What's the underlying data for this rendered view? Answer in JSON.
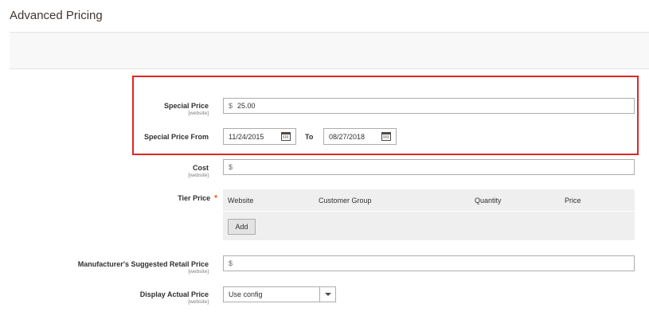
{
  "page": {
    "title": "Advanced Pricing"
  },
  "fields": {
    "special_price": {
      "label": "Special Price",
      "scope": "[website]",
      "currency": "$",
      "value": "25.00"
    },
    "special_price_from": {
      "label": "Special Price From",
      "from_value": "11/24/2015",
      "to_label": "To",
      "to_value": "08/27/2018"
    },
    "cost": {
      "label": "Cost",
      "scope": "[website]",
      "currency": "$",
      "value": ""
    },
    "tier_price": {
      "label": "Tier Price",
      "required_mark": "*",
      "columns": [
        "Website",
        "Customer Group",
        "Quantity",
        "Price"
      ],
      "add_label": "Add"
    },
    "msrp": {
      "label": "Manufacturer's Suggested Retail Price",
      "scope": "[website]",
      "currency": "$",
      "value": ""
    },
    "display_actual_price": {
      "label": "Display Actual Price",
      "scope": "[website]",
      "value": "Use config"
    }
  },
  "colors": {
    "highlight": "#e22626",
    "required": "#eb5202"
  },
  "icons": [
    "calendar-icon",
    "chevron-down-icon"
  ]
}
